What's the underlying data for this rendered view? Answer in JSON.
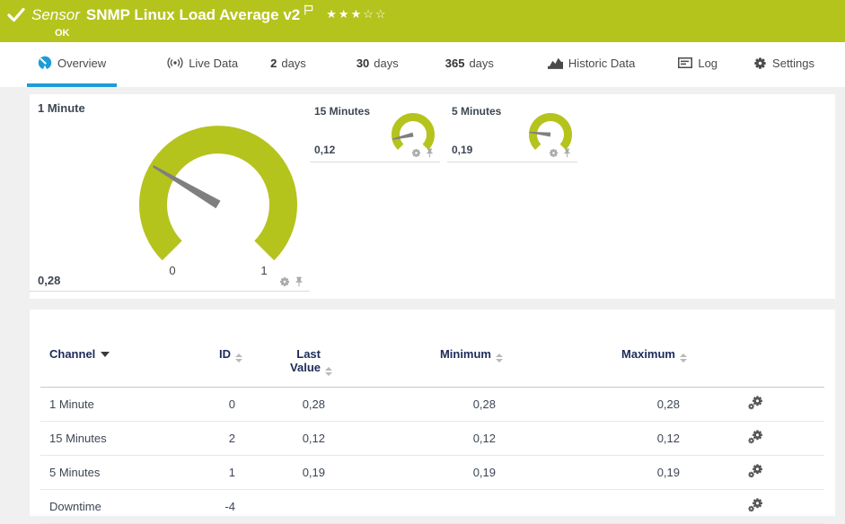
{
  "colors": {
    "status_green": "#b5c31d",
    "accent_blue": "#1e9cd7",
    "header_navy": "#1c2b5a",
    "needle_gray": "#7f7f7f"
  },
  "header": {
    "kind": "Sensor",
    "title": "SNMP Linux Load Average v2",
    "status": "OK",
    "rating": {
      "filled": "★★★",
      "empty": "☆☆"
    }
  },
  "tabs": [
    {
      "label": "Overview",
      "icon": "gauge-icon",
      "active": true
    },
    {
      "label": "Live Data",
      "icon": "broadcast-icon",
      "active": false
    },
    {
      "number": "2",
      "label": "days",
      "active": false
    },
    {
      "number": "30",
      "label": "days",
      "active": false
    },
    {
      "number": "365",
      "label": "days",
      "active": false
    },
    {
      "label": "Historic Data",
      "icon": "area-chart-icon",
      "active": false
    },
    {
      "label": "Log",
      "icon": "log-icon",
      "active": false
    },
    {
      "label": "Settings",
      "icon": "gear-icon",
      "active": false
    }
  ],
  "gauge_scale": {
    "min": 0,
    "max": 1,
    "min_label": "0",
    "max_label": "1",
    "start_angle_deg": 225,
    "sweep_deg": 270
  },
  "gauges": {
    "primary": {
      "label": "1 Minute",
      "value": 0.28,
      "value_text": "0,28"
    },
    "secondary": [
      {
        "label": "15 Minutes",
        "value": 0.12,
        "value_text": "0,12"
      },
      {
        "label": "5 Minutes",
        "value": 0.19,
        "value_text": "0,19"
      }
    ]
  },
  "table": {
    "columns": {
      "channel": "Channel",
      "id": "ID",
      "last": "Last Value",
      "min": "Minimum",
      "max": "Maximum"
    },
    "rows": [
      {
        "channel": "1 Minute",
        "id": "0",
        "last": "0,28",
        "min": "0,28",
        "max": "0,28"
      },
      {
        "channel": "15 Minutes",
        "id": "2",
        "last": "0,12",
        "min": "0,12",
        "max": "0,12"
      },
      {
        "channel": "5 Minutes",
        "id": "1",
        "last": "0,19",
        "min": "0,19",
        "max": "0,19"
      },
      {
        "channel": "Downtime",
        "id": "-4",
        "last": "",
        "min": "",
        "max": ""
      }
    ]
  }
}
